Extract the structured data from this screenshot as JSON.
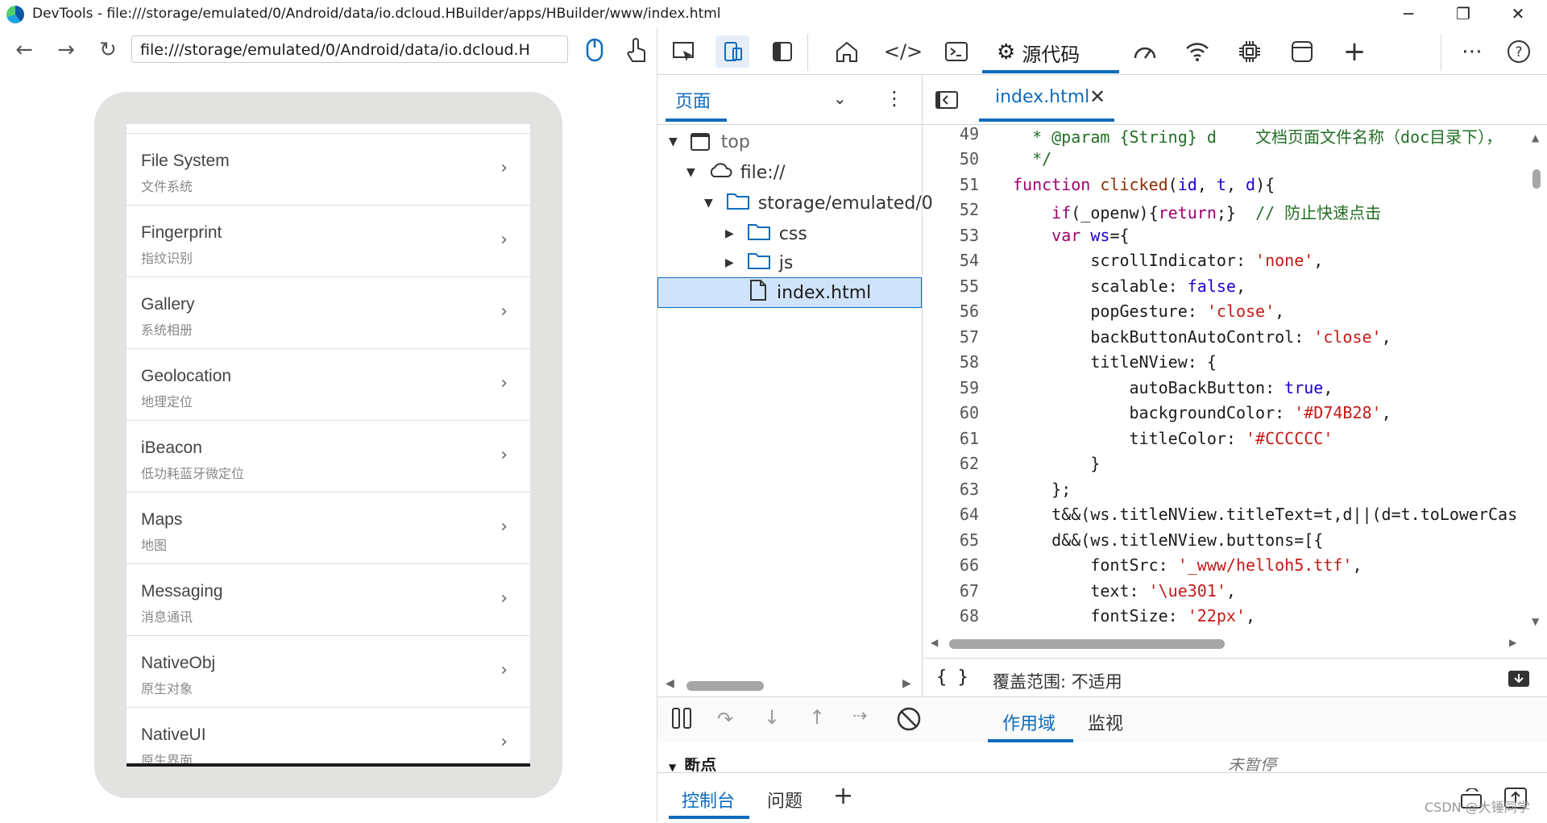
{
  "window": {
    "title": "DevTools - file:///storage/emulated/0/Android/data/io.dcloud.HBuilder/apps/HBuilder/www/index.html",
    "minimize": "─",
    "maximize": "❐",
    "close": "✕"
  },
  "browser": {
    "url": "file:///storage/emulated/0/Android/data/io.dcloud.H",
    "back": "←",
    "forward": "→",
    "reload": "↻"
  },
  "device_list": [
    {
      "title": "File System",
      "subtitle": "文件系统"
    },
    {
      "title": "Fingerprint",
      "subtitle": "指纹识别"
    },
    {
      "title": "Gallery",
      "subtitle": "系统相册"
    },
    {
      "title": "Geolocation",
      "subtitle": "地理定位"
    },
    {
      "title": "iBeacon",
      "subtitle": "低功耗蓝牙微定位"
    },
    {
      "title": "Maps",
      "subtitle": "地图"
    },
    {
      "title": "Messaging",
      "subtitle": "消息通讯"
    },
    {
      "title": "NativeObj",
      "subtitle": "原生对象"
    },
    {
      "title": "NativeUI",
      "subtitle": "原生界面"
    }
  ],
  "devtools": {
    "sources_tab": "源代码",
    "navigator": {
      "page_tab": "页面",
      "tree": {
        "top": "top",
        "origin": "file://",
        "folder": "storage/emulated/0",
        "css": "css",
        "js": "js",
        "file": "index.html"
      }
    },
    "editor": {
      "tab": "index.html",
      "lines": [
        "49",
        "50",
        "51",
        "52",
        "53",
        "54",
        "55",
        "56",
        "57",
        "58",
        "59",
        "60",
        "61",
        "62",
        "63",
        "64",
        "65",
        "66",
        "67",
        "68"
      ]
    },
    "coverage": "覆盖范围: 不适用",
    "coverage_braces": "{ }",
    "debugger": {
      "scope_tab": "作用域",
      "watch_tab": "监视",
      "breakpoints": "断点",
      "not_paused": "未暂停"
    },
    "drawer": {
      "console": "控制台",
      "issues": "问题",
      "add": "+"
    }
  },
  "watermark": "CSDN @大锤同学"
}
